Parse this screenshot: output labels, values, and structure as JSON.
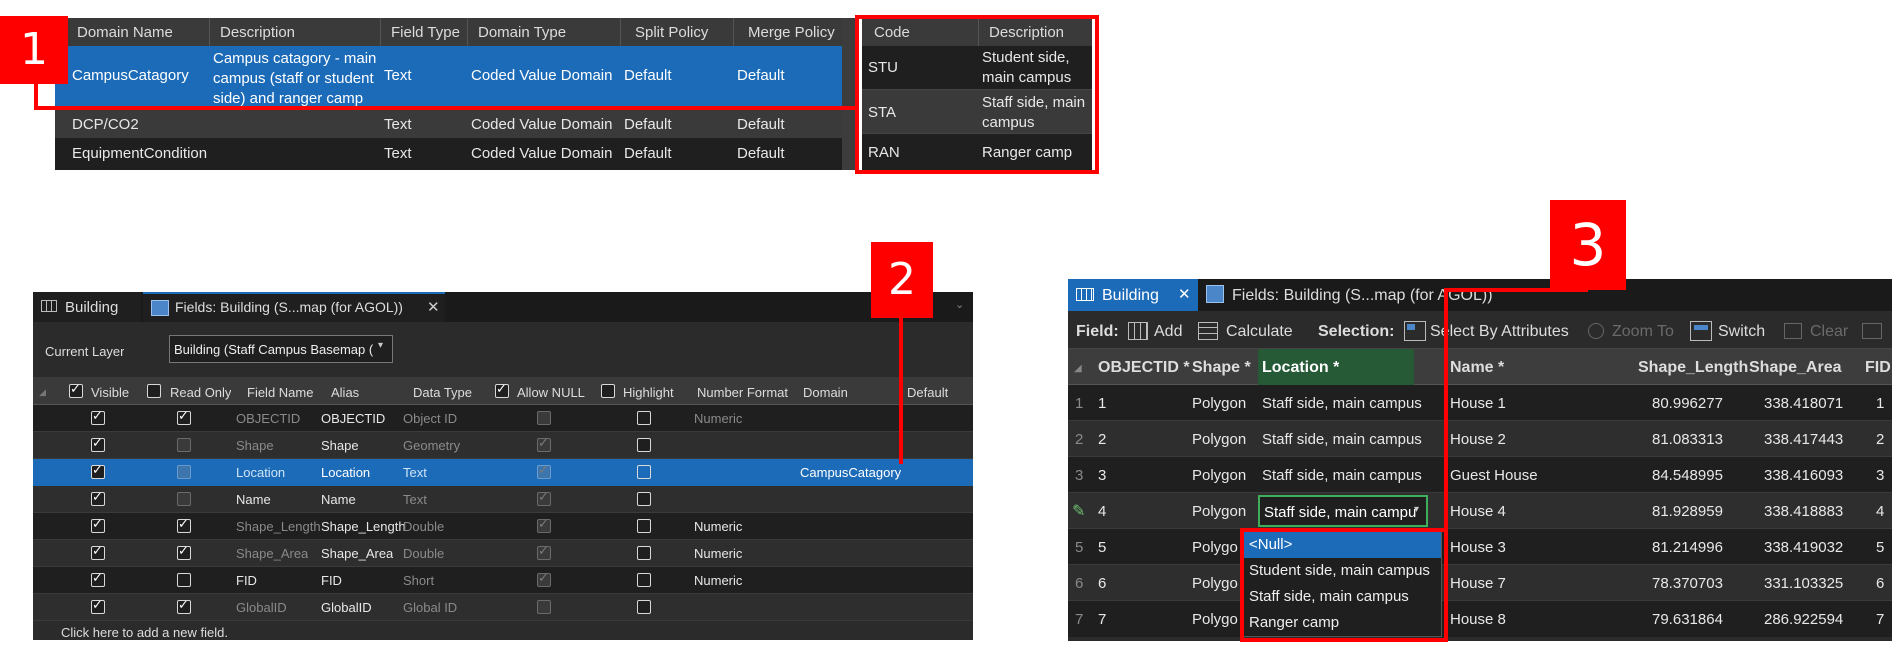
{
  "badges": {
    "b1": "1",
    "b2": "2",
    "b3": "3"
  },
  "domains": {
    "headers": [
      "Domain Name",
      "Description",
      "Field Type",
      "Domain Type",
      "Split Policy",
      "Merge Policy"
    ],
    "rows": [
      {
        "name": "CampusCatagory",
        "description": "Campus catagory - main campus (staff or student side) and ranger camp",
        "field_type": "Text",
        "domain_type": "Coded Value Domain",
        "split": "Default",
        "merge": "Default"
      },
      {
        "name": "DCP/CO2",
        "description": "",
        "field_type": "Text",
        "domain_type": "Coded Value Domain",
        "split": "Default",
        "merge": "Default"
      },
      {
        "name": "EquipmentCondition",
        "description": "",
        "field_type": "Text",
        "domain_type": "Coded Value Domain",
        "split": "Default",
        "merge": "Default"
      }
    ],
    "desc_line1": "Campus catagory - main",
    "desc_line2": "campus (staff or student",
    "desc_line3": "side) and ranger camp"
  },
  "codes": {
    "headers": [
      "Code",
      "Description"
    ],
    "rows": [
      {
        "code": "STU",
        "d1": "Student side,",
        "d2": "main campus"
      },
      {
        "code": "STA",
        "d1": "Staff side, main",
        "d2": "campus"
      },
      {
        "code": "RAN",
        "d1": "Ranger camp",
        "d2": ""
      }
    ]
  },
  "fields_view": {
    "tab_building": "Building",
    "tab_fields": "Fields:  Building (S...map (for AGOL))",
    "current_layer_label": "Current Layer",
    "current_layer_value": "Building (Staff Campus Basemap (",
    "headers": [
      "Visible",
      "Read Only",
      "Field Name",
      "Alias",
      "Data Type",
      "Allow NULL",
      "Highlight",
      "Number Format",
      "Domain",
      "Default"
    ],
    "rows": [
      {
        "name": "OBJECTID",
        "alias": "OBJECTID",
        "type": "Object ID",
        "format": "Numeric",
        "domain": ""
      },
      {
        "name": "Shape",
        "alias": "Shape",
        "type": "Geometry",
        "format": "",
        "domain": ""
      },
      {
        "name": "Location",
        "alias": "Location",
        "type": "Text",
        "format": "",
        "domain": "CampusCatagory"
      },
      {
        "name": "Name",
        "alias": "Name",
        "type": "Text",
        "format": "",
        "domain": ""
      },
      {
        "name": "Shape_Length",
        "alias": "Shape_Length",
        "type": "Double",
        "format": "Numeric",
        "domain": ""
      },
      {
        "name": "Shape_Area",
        "alias": "Shape_Area",
        "type": "Double",
        "format": "Numeric",
        "domain": ""
      },
      {
        "name": "FID",
        "alias": "FID",
        "type": "Short",
        "format": "Numeric",
        "domain": ""
      },
      {
        "name": "GlobalID",
        "alias": "GlobalID",
        "type": "Global ID",
        "format": "",
        "domain": ""
      }
    ],
    "add_field": "Click here to add a new field."
  },
  "table_view": {
    "tab_building": "Building",
    "tab_fields": "Fields:  Building (S...map (for AGOL))",
    "toolbar": {
      "field_label": "Field:",
      "add": "Add",
      "calculate": "Calculate",
      "selection_label": "Selection:",
      "select_by_attributes": "Select By Attributes",
      "zoom_to": "Zoom To",
      "switch": "Switch",
      "clear": "Clear"
    },
    "headers": [
      "OBJECTID *",
      "Shape *",
      "Location *",
      "Name *",
      "Shape_Length",
      "Shape_Area",
      "FID"
    ],
    "rows": [
      {
        "n": "1",
        "oid": "1",
        "shape": "Polygon",
        "loc": "Staff side, main campus",
        "name": "House 1",
        "len": "80.996277",
        "area": "338.418071",
        "fid": "1"
      },
      {
        "n": "2",
        "oid": "2",
        "shape": "Polygon",
        "loc": "Staff side, main campus",
        "name": "House 2",
        "len": "81.083313",
        "area": "338.417443",
        "fid": "2"
      },
      {
        "n": "3",
        "oid": "3",
        "shape": "Polygon",
        "loc": "Staff side, main campus",
        "name": "Guest House",
        "len": "84.548995",
        "area": "338.416093",
        "fid": "3"
      },
      {
        "n": "",
        "oid": "4",
        "shape": "Polygon",
        "loc": "Staff side, main campu",
        "name": "House 4",
        "len": "81.928959",
        "area": "338.418883",
        "fid": "4"
      },
      {
        "n": "5",
        "oid": "5",
        "shape": "Polygo",
        "loc": "",
        "name": "House 3",
        "len": "81.214996",
        "area": "338.419032",
        "fid": "5"
      },
      {
        "n": "6",
        "oid": "6",
        "shape": "Polygo",
        "loc": "",
        "name": "House 7",
        "len": "78.370703",
        "area": "331.103325",
        "fid": "6"
      },
      {
        "n": "7",
        "oid": "7",
        "shape": "Polygo",
        "loc": "",
        "name": "House 8",
        "len": "79.631864",
        "area": "286.922594",
        "fid": "7"
      }
    ],
    "dropdown": [
      "<Null>",
      "Student side, main campus",
      "Staff side, main campus",
      "Ranger camp"
    ]
  },
  "colors": {
    "accent_red": "#ff0000",
    "selection_blue": "#1c6bb8",
    "dark_bg": "#1f1f1f"
  }
}
